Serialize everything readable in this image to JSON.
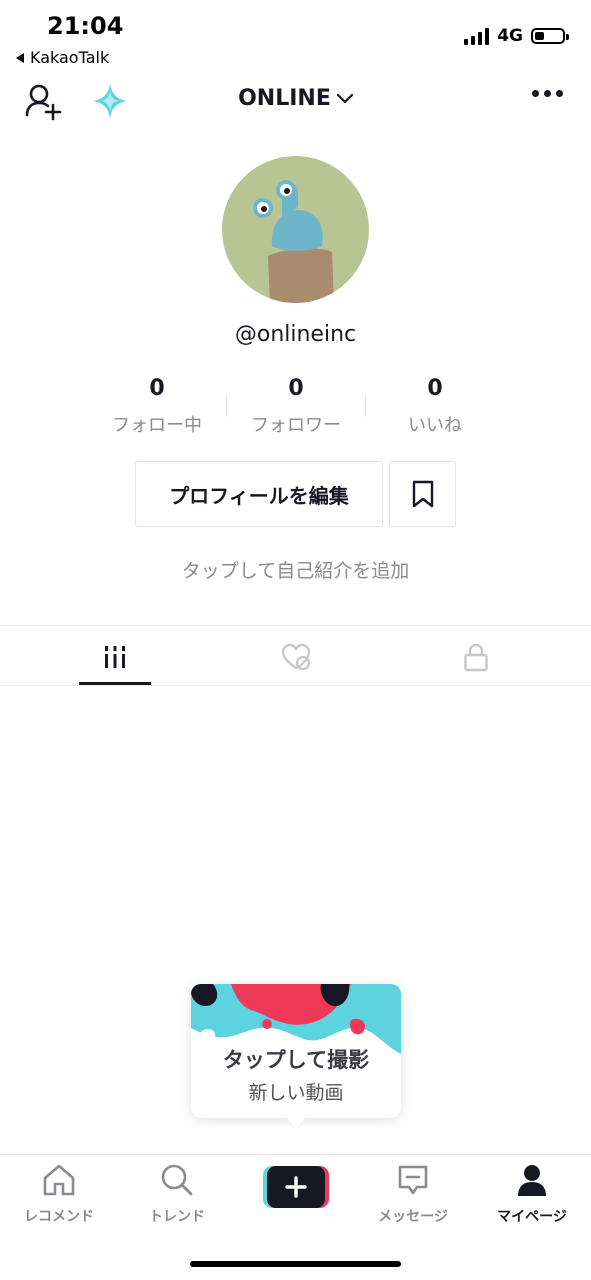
{
  "status_bar": {
    "time": "21:04",
    "back_app": "KakaoTalk",
    "network": "4G"
  },
  "header": {
    "title": "ONLINE",
    "icons": [
      "add-user-icon",
      "sparkle-icon",
      "chevron-down-icon",
      "more-icon"
    ]
  },
  "profile": {
    "username": "@onlineinc",
    "stats": [
      {
        "value": "0",
        "label": "フォロー中"
      },
      {
        "value": "0",
        "label": "フォロワー"
      },
      {
        "value": "0",
        "label": "いいね"
      }
    ],
    "edit_label": "プロフィールを編集",
    "bio_prompt": "タップして自己紹介を追加"
  },
  "tabs": [
    "videos-grid-icon",
    "liked-icon",
    "lock-icon"
  ],
  "popup": {
    "line1": "タップして撮影",
    "line2": "新しい動画"
  },
  "bottom_nav": {
    "items": [
      {
        "label": "レコメンド",
        "icon": "home-icon"
      },
      {
        "label": "トレンド",
        "icon": "search-icon"
      },
      {
        "label": "",
        "icon": "plus-icon"
      },
      {
        "label": "メッセージ",
        "icon": "message-icon"
      },
      {
        "label": "マイページ",
        "icon": "profile-icon"
      }
    ]
  },
  "colors": {
    "accent_cyan": "#5dd3e0",
    "accent_red": "#ee3a58",
    "text_primary": "#161823",
    "text_secondary": "#8a8b91"
  }
}
